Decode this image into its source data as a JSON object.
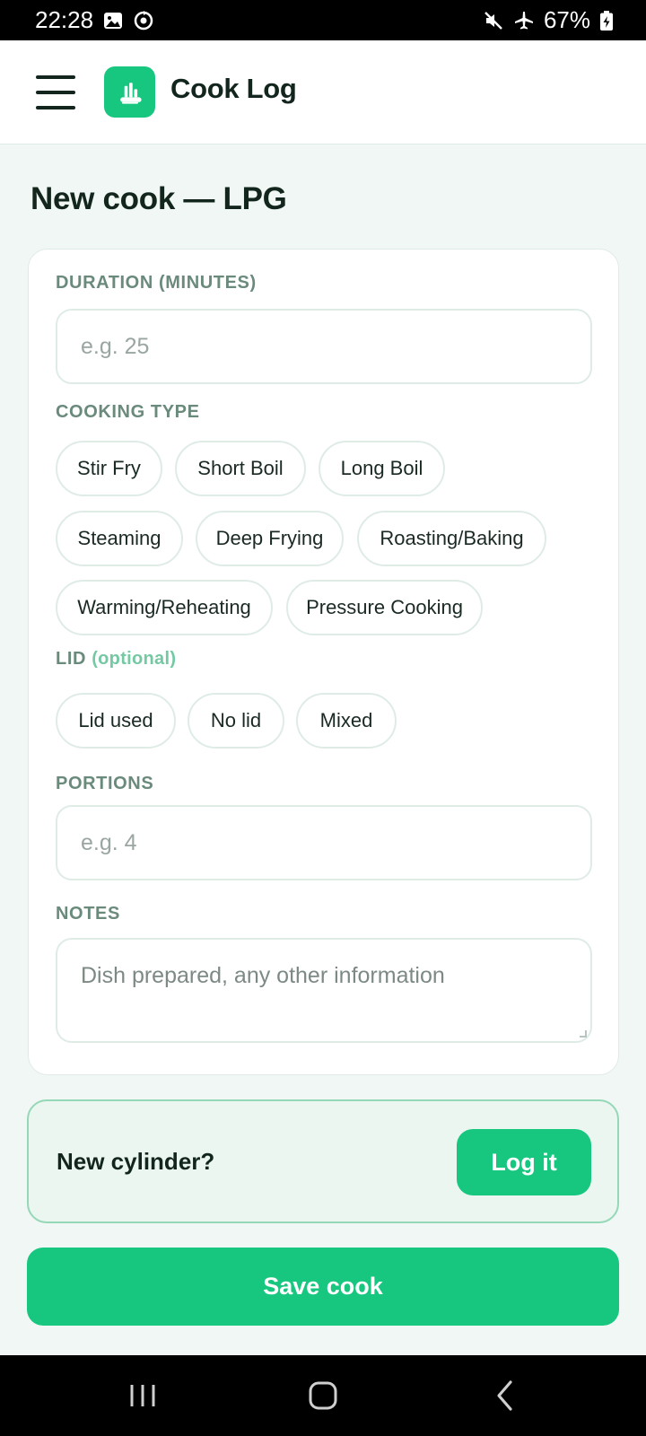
{
  "status_bar": {
    "time": "22:28",
    "battery": "67%",
    "left_icons": [
      "image-icon",
      "sync-icon"
    ],
    "right_icons": [
      "mute-icon",
      "airplane-mode-icon",
      "battery-charging-icon"
    ]
  },
  "header": {
    "app_title": "Cook Log",
    "logo_icon": "cook-log-logo-icon",
    "menu_icon": "hamburger-menu-icon"
  },
  "page": {
    "title": "New cook — LPG"
  },
  "form": {
    "duration": {
      "label": "DURATION (MINUTES)",
      "placeholder": "e.g. 25",
      "value": ""
    },
    "cooking_type": {
      "label": "COOKING TYPE",
      "options": [
        "Stir Fry",
        "Short Boil",
        "Long Boil",
        "Steaming",
        "Deep Frying",
        "Roasting/Baking",
        "Warming/Reheating",
        "Pressure Cooking"
      ]
    },
    "lid": {
      "label": "LID",
      "optional_tag": "(optional)",
      "options": [
        "Lid used",
        "No lid",
        "Mixed"
      ]
    },
    "portions": {
      "label": "PORTIONS",
      "placeholder": "e.g. 4",
      "value": ""
    },
    "notes": {
      "label": "NOTES",
      "placeholder": "Dish prepared, any other information",
      "value": ""
    }
  },
  "cylinder": {
    "question": "New cylinder?",
    "button_label": "Log it"
  },
  "actions": {
    "save_label": "Save cook"
  },
  "colors": {
    "accent": "#17c77f",
    "background": "#f1f7f4",
    "text": "#13261d",
    "label": "#6a8a7c"
  },
  "nav_bar": {
    "icons": [
      "recents-icon",
      "home-icon",
      "back-icon"
    ]
  }
}
